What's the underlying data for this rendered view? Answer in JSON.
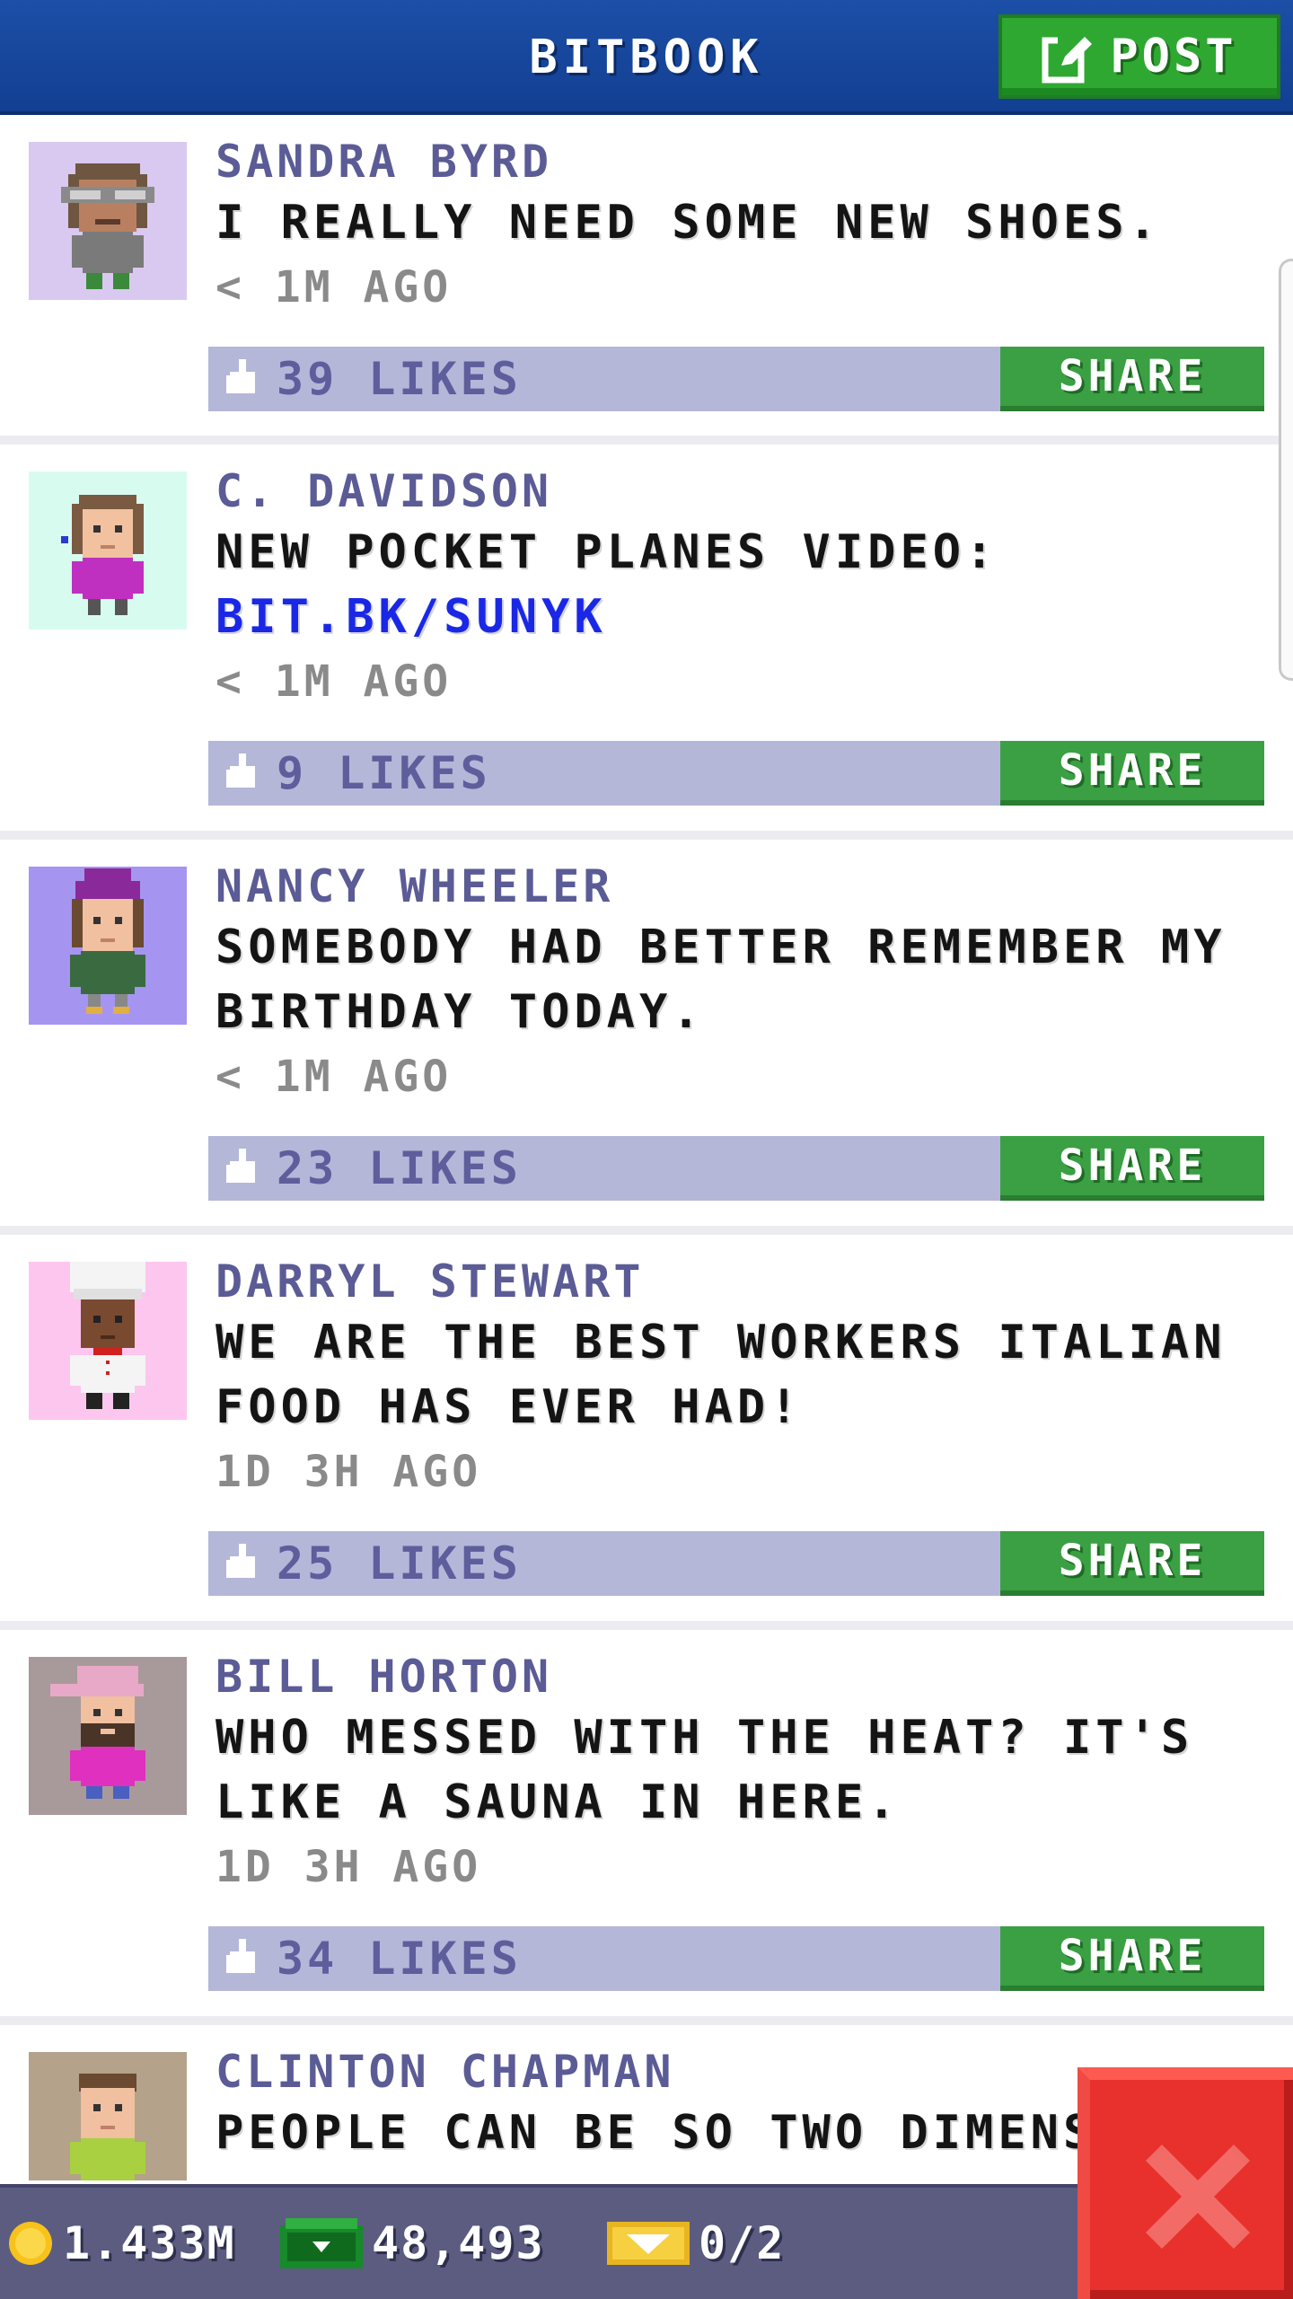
{
  "header": {
    "title": "BITBOOK",
    "post_label": "POST"
  },
  "posts": [
    {
      "author": "SANDRA BYRD",
      "message": "I REALLY NEED SOME NEW SHOES.",
      "link": "",
      "time": "< 1M AGO",
      "likes": "39 LIKES",
      "share": "SHARE",
      "avatar_bg": "#d9c8ef"
    },
    {
      "author": "C. DAVIDSON",
      "message": "NEW POCKET PLANES VIDEO:",
      "link": "BIT.BK/SUNYK",
      "time": "< 1M AGO",
      "likes": "9 LIKES",
      "share": "SHARE",
      "avatar_bg": "#d8fbf0"
    },
    {
      "author": "NANCY WHEELER",
      "message": "SOMEBODY HAD BETTER REMEMBER MY BIRTHDAY TODAY.",
      "link": "",
      "time": "< 1M AGO",
      "likes": "23 LIKES",
      "share": "SHARE",
      "avatar_bg": "#a595f0"
    },
    {
      "author": "DARRYL STEWART",
      "message": "WE ARE THE BEST WORKERS ITALIAN FOOD HAS EVER HAD!",
      "link": "",
      "time": "1D 3H AGO",
      "likes": "25 LIKES",
      "share": "SHARE",
      "avatar_bg": "#fcc6ef"
    },
    {
      "author": "BILL HORTON",
      "message": "WHO MESSED WITH THE HEAT? IT'S LIKE A SAUNA IN HERE.",
      "link": "",
      "time": "1D 3H AGO",
      "likes": "34 LIKES",
      "share": "SHARE",
      "avatar_bg": "#a89a9a"
    },
    {
      "author": "CLINTON CHAPMAN",
      "message": "PEOPLE CAN BE SO TWO DIMENS",
      "link": "",
      "time": "",
      "likes": "",
      "share": "",
      "avatar_bg": "#b4a28a"
    }
  ],
  "status": {
    "coins": "1.433M",
    "bux": "48,493",
    "tickets": "0/2"
  },
  "colors": {
    "header": "#164aa0",
    "post_button": "#2fa832",
    "share_button": "#3aa043",
    "likes_bar": "#b4b7d8",
    "statusbar": "#5b5c80",
    "close_button": "#e8302c"
  },
  "icons": {
    "post": "edit-icon",
    "like": "thumbs-up-icon",
    "coin": "coin-icon",
    "bux": "bux-icon",
    "ticket": "ticket-icon",
    "close": "close-icon"
  }
}
